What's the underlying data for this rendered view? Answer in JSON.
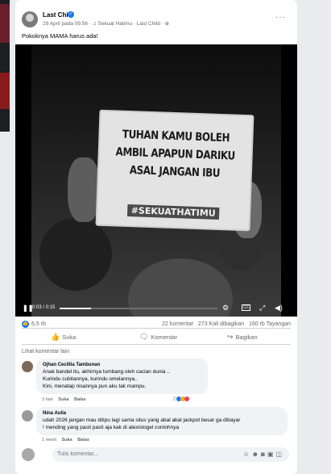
{
  "post": {
    "page_name": "Last Child",
    "date": "29 April pada 09.56",
    "music": "Sekuat Hatimu · Last Child",
    "caption": "Pokoknya MAMA harus ada!"
  },
  "video": {
    "sign_lines": [
      "TUHAN KAMU BOLEH",
      "AMBIL APAPUN DARIKU",
      "ASAL JANGAN IBU"
    ],
    "sign_hashtag": "#SEKUATHATIMU",
    "time": "0:03 / 0:15",
    "progress": 0.2,
    "cc_label": "CC"
  },
  "stats": {
    "reactions": "6,5 rb",
    "comments": "22 komentar",
    "shares": "273 Kali dibagikan",
    "views": "160 rb Tayangan"
  },
  "actions": {
    "like": "Suka",
    "comment": "Komentar",
    "share": "Bagikan"
  },
  "comments": {
    "view_more": "Lihat komentar lain",
    "items": [
      {
        "name": "Ojhan Cecillia Tambunan",
        "lines": [
          "Anak bandel itu, akhirnya tumbang oleh cacian dunia ..",
          "Kurindu cubitannya, kurindu omelannya..",
          "Kini, menatap nisannya pun aku tak mampu."
        ],
        "time": "3 hari",
        "like": "Suka",
        "reply": "Balas",
        "reaction_count": "2"
      },
      {
        "name": "Nina Aulia",
        "lines": [
          "udah 2026 jangan mau ditipu lagi sama situs yang abal abal jackpot besar ga dibayar",
          "! mending yang pasti pasti aja kak di alexistogel contohnya"
        ],
        "time": "1 menit",
        "like": "Suka",
        "reply": "Balas"
      }
    ]
  },
  "compose": {
    "placeholder": "Tulis komentar..."
  },
  "colors": {
    "accent": "#1877f2",
    "bubble": "#f0f2f5",
    "muted": "#65676b"
  }
}
